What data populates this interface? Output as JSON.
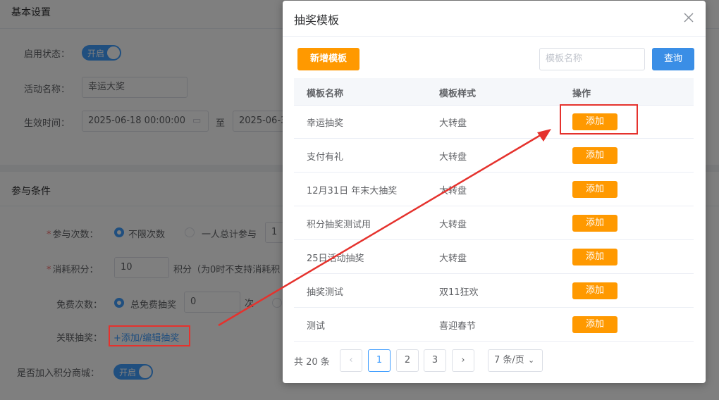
{
  "basic": {
    "title": "基本设置",
    "enable_label": "启用状态：",
    "enable_toggle": "开启",
    "name_label": "活动名称：",
    "name_value": "幸运大奖",
    "time_label": "生效时间：",
    "start_time": "2025-06-18 00:00:00",
    "to": "至",
    "end_time_partial": "2025-06-3"
  },
  "conditions": {
    "title": "参与条件",
    "times_label": "参与次数：",
    "times_opt1": "不限次数",
    "times_opt2": "一人总计参与",
    "times_input": "1",
    "points_label": "消耗积分：",
    "points_value": "10",
    "points_suffix": "积分（为0时不支持消耗积",
    "free_label": "免费次数：",
    "free_opt1": "总免费抽奖",
    "free_value": "0",
    "free_unit": "次",
    "link_label": "关联抽奖：",
    "link_text": "+添加/编辑抽奖",
    "mall_label": "是否加入积分商城：",
    "mall_toggle": "开启"
  },
  "dialog": {
    "title": "抽奖模板",
    "new_button": "新增模板",
    "search_placeholder": "模板名称",
    "query_button": "查询",
    "columns": [
      "模板名称",
      "模板样式",
      "操作"
    ],
    "rows": [
      {
        "name": "幸运抽奖",
        "style": "大转盘",
        "action": "添加"
      },
      {
        "name": "支付有礼",
        "style": "大转盘",
        "action": "添加"
      },
      {
        "name": "12月31日 年末大抽奖",
        "style": "大转盘",
        "action": "添加"
      },
      {
        "name": "积分抽奖测试用",
        "style": "大转盘",
        "action": "添加"
      },
      {
        "name": "25日活动抽奖",
        "style": "大转盘",
        "action": "添加"
      },
      {
        "name": "抽奖测试",
        "style": "双11狂欢",
        "action": "添加"
      },
      {
        "name": "测试",
        "style": "喜迎春节",
        "action": "添加"
      }
    ],
    "pagination": {
      "total": "共 20 条",
      "pages": [
        "1",
        "2",
        "3"
      ],
      "current": "1",
      "page_size": "7 条/页"
    }
  },
  "colors": {
    "accent_orange": "#ff9900",
    "primary_blue": "#409eff",
    "annotation_red": "#e5322d"
  }
}
